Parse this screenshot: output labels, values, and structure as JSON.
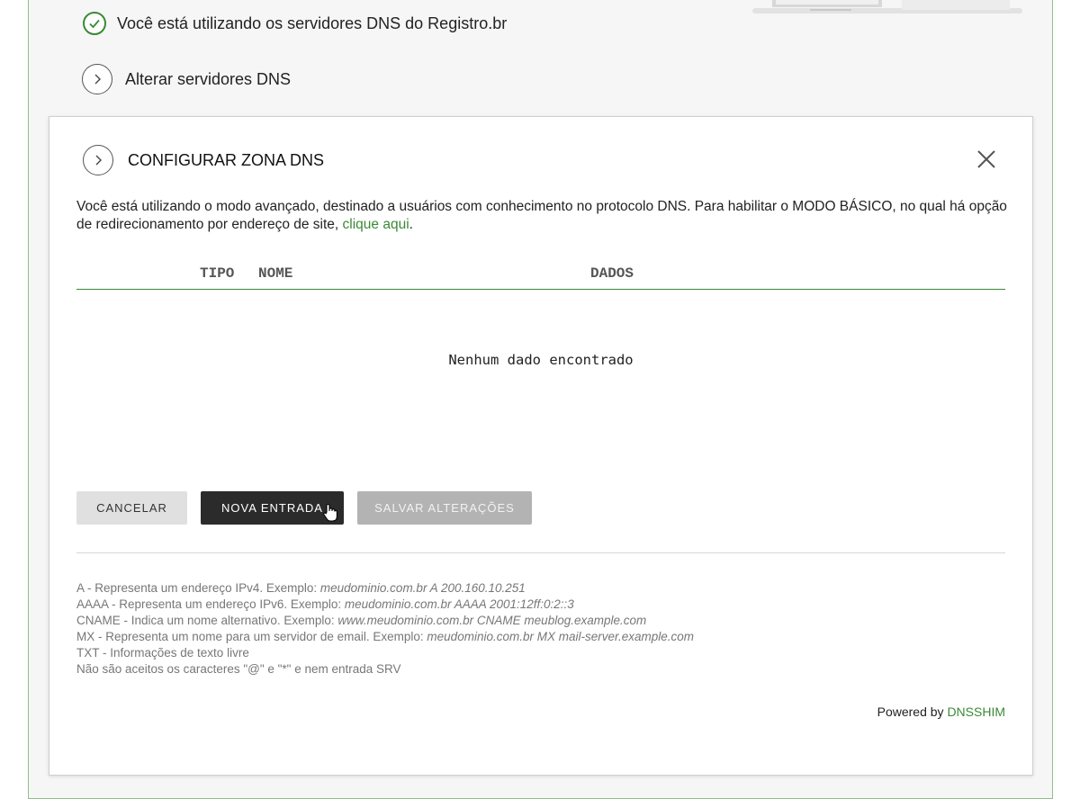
{
  "status": {
    "dns_message": "Você está utilizando os servidores DNS do Registro.br",
    "alter_dns_label": "Alterar servidores DNS"
  },
  "modal": {
    "title": "CONFIGURAR ZONA DNS",
    "notice_text": "Você está utilizando o modo avançado, destinado a usuários com conhecimento no protocolo DNS. Para habilitar o MODO BÁSICO, no qual há opção de redirecionamento por endereço de site, ",
    "notice_link": "clique aqui",
    "notice_end": ".",
    "table": {
      "columns": [
        "TIPO",
        "NOME",
        "DADOS"
      ],
      "empty_message": "Nenhum dado encontrado"
    },
    "buttons": {
      "cancel": "CANCELAR",
      "new_entry": "NOVA ENTRADA",
      "save": "SALVAR ALTERAÇÕES"
    },
    "help": [
      {
        "text": "A - Representa um endereço IPv4. Exemplo: ",
        "example": "meudominio.com.br A 200.160.10.251"
      },
      {
        "text": "AAAA - Representa um endereço IPv6. Exemplo: ",
        "example": "meudominio.com.br AAAA 2001:12ff:0:2::3"
      },
      {
        "text": "CNAME - Indica um nome alternativo. Exemplo: ",
        "example": "www.meudominio.com.br CNAME meublog.example.com"
      },
      {
        "text": "MX - Representa um nome para um servidor de email. Exemplo: ",
        "example": "meudominio.com.br MX mail-server.example.com"
      },
      {
        "text": "TXT - Informações de texto livre",
        "example": ""
      },
      {
        "text": "Não são aceitos os caracteres \"@\" e \"*\" e nem entrada SRV",
        "example": ""
      }
    ],
    "powered_prefix": "Powered by ",
    "powered_link": "DNSSHIM"
  },
  "colors": {
    "accent_green": "#3a8a35",
    "dark_button": "#2b2b2b",
    "disabled_button": "#b3b3b3"
  }
}
